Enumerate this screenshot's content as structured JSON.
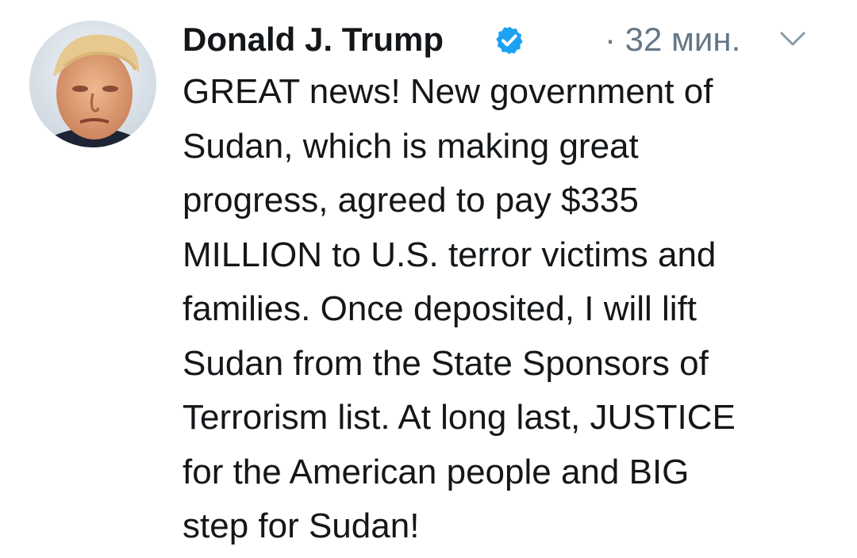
{
  "tweet": {
    "author_name": "Donald J. Trump",
    "verified_icon": "verified-badge-icon",
    "timestamp": "· 32 мин.",
    "menu_icon": "chevron-down-icon",
    "avatar_icon": "profile-photo",
    "text_lines": [
      "GREAT news! New government of",
      "Sudan, which is making great",
      "progress, agreed to pay $335",
      "MILLION to U.S. terror victims and",
      "families. Once deposited, I will lift",
      "Sudan from the State Sponsors of",
      "Terrorism list. At long last, JUSTICE",
      "for the American people and BIG",
      "step for Sudan!"
    ]
  },
  "colors": {
    "text": "#14171a",
    "secondary": "#657786",
    "verified": "#1da1f2",
    "background": "#ffffff"
  }
}
